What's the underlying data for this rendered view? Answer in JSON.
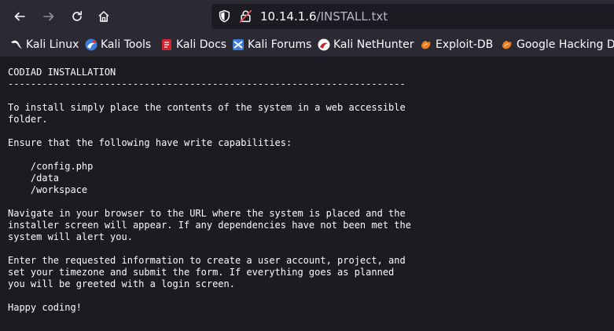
{
  "browser": {
    "url_host": "10.14.1.6",
    "url_path": "/INSTALL.txt",
    "back_icon": "arrow-left-icon",
    "forward_icon": "arrow-right-icon",
    "reload_icon": "reload-icon",
    "home_icon": "home-icon"
  },
  "bookmarks": [
    {
      "label": "Kali Linux",
      "icon": "kali-dragon-icon"
    },
    {
      "label": "Kali Tools",
      "icon": "kali-tools-icon"
    },
    {
      "label": "Kali Docs",
      "icon": "kali-docs-icon"
    },
    {
      "label": "Kali Forums",
      "icon": "kali-forums-icon"
    },
    {
      "label": "Kali NetHunter",
      "icon": "nethunter-icon"
    },
    {
      "label": "Exploit-DB",
      "icon": "exploit-db-icon"
    },
    {
      "label": "Google Hacking DB",
      "icon": "ghdb-icon"
    }
  ],
  "document": {
    "text": "CODIAD INSTALLATION\n----------------------------------------------------------------------\n\nTo install simply place the contents of the system in a web accessible\nfolder.\n\nEnsure that the following have write capabilities:\n\n    /config.php\n    /data\n    /workspace\n\nNavigate in your browser to the URL where the system is placed and the\ninstaller screen will appear. If any dependencies have not been met the\nsystem will alert you.\n\nEnter the requested information to create a user account, project, and\nset your timezone and submit the form. If everything goes as planned\nyou will be greeted with a login screen.\n\nHappy coding!"
  },
  "colors": {
    "toolbar": "#2b2a33",
    "page": "#1c1b22",
    "text": "#fbfbfe",
    "urlbar": "#1c1b22"
  }
}
